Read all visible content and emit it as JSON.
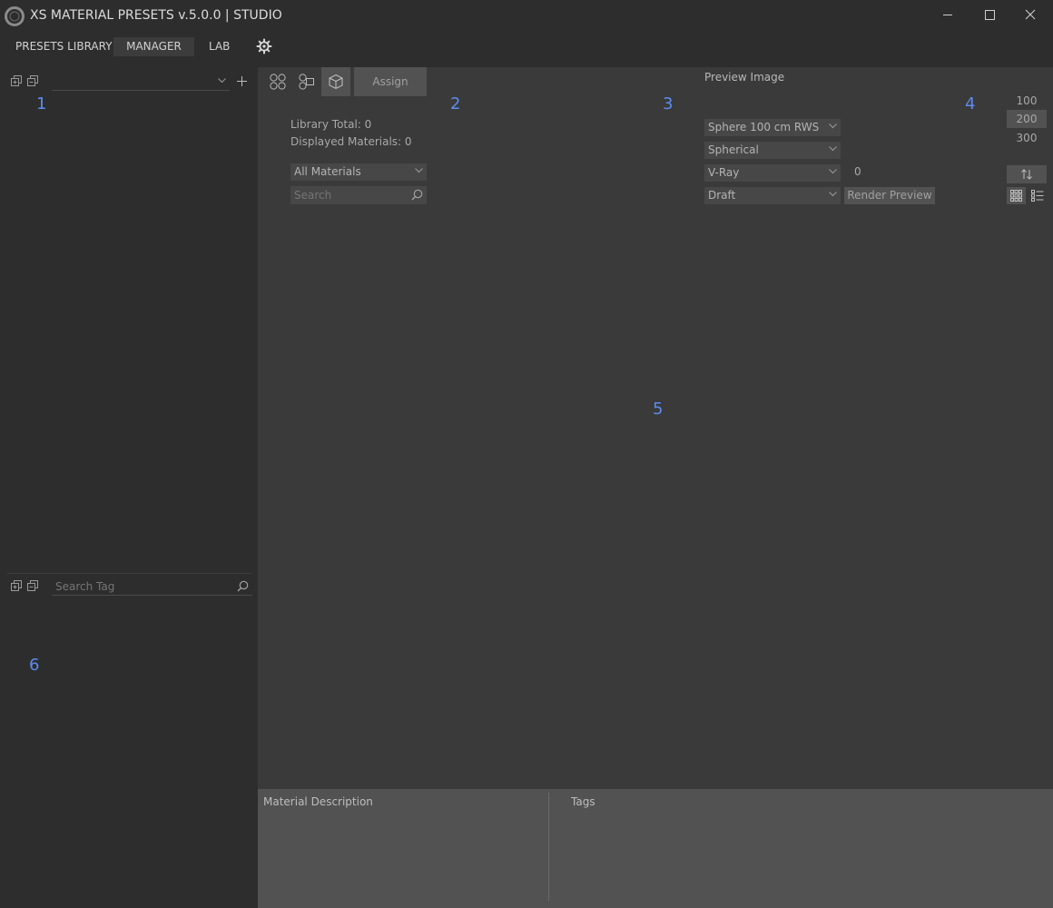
{
  "window": {
    "title": "XS MATERIAL PRESETS v.5.0.0 | STUDIO"
  },
  "menu": {
    "items": [
      "PRESETS LIBRARY",
      "MANAGER",
      "LAB"
    ],
    "active": "MANAGER"
  },
  "left": {
    "library_select_value": "",
    "marker_1": "1",
    "tag_search_placeholder": "Search Tag",
    "marker_6": "6"
  },
  "toolbar": {
    "assign_label": "Assign"
  },
  "library": {
    "total_label": "Library Total: 0",
    "displayed_label": "Displayed Materials: 0",
    "filter_value": "All Materials",
    "search_placeholder": "Search"
  },
  "markers": {
    "m2": "2",
    "m3": "3",
    "m4": "4",
    "m5": "5"
  },
  "preview": {
    "title": "Preview Image",
    "scene_value": "Sphere 100 cm RWS",
    "mapping_value": "Spherical",
    "renderer_value": "V-Ray",
    "renderer_count": "0",
    "quality_value": "Draft",
    "render_button": "Render Preview"
  },
  "sizes": {
    "options": [
      "100",
      "200",
      "300"
    ],
    "selected": "200"
  },
  "bottom": {
    "description_label": "Material Description",
    "tags_label": "Tags"
  },
  "colors": {
    "accent_blue": "#5b8cf0",
    "background": "#2d2d2d",
    "panel": "#3a3a3a",
    "bottom_panel": "#525252"
  }
}
